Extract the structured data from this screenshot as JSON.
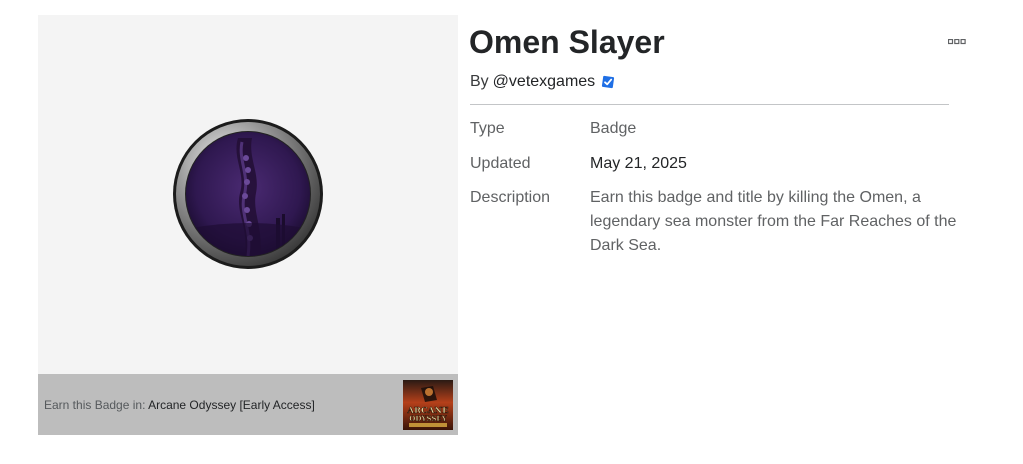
{
  "badge": {
    "title": "Omen Slayer",
    "creator_prefix": "By",
    "creator_name": "@vetexgames",
    "details": {
      "type_label": "Type",
      "type_value": "Badge",
      "updated_label": "Updated",
      "updated_value": "May 21, 2025",
      "description_label": "Description",
      "description_value": "Earn this badge and title by killing the Omen, a legendary sea monster from the Far Reaches of the Dark Sea."
    }
  },
  "game": {
    "earn_prefix": "Earn this Badge in:",
    "name": "Arcane Odyssey [Early Access]",
    "thumb_text_1": "ARCANE",
    "thumb_text_2": "ODYSSEY"
  },
  "colors": {
    "badge_purple": "#3a1f5c",
    "verified_blue": "#1f6fe5",
    "thumb_orange": "#d3541c"
  },
  "icons": {
    "verified": "verified-badge-icon",
    "more": "more-options-icon"
  }
}
